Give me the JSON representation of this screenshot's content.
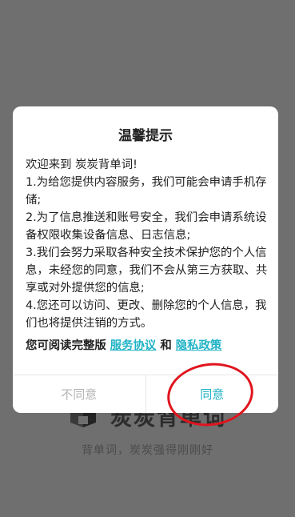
{
  "background": {
    "app_name": "炭炭背单词",
    "tagline": "背单词，炭炭强得刚刚好"
  },
  "dialog": {
    "title": "温馨提示",
    "paragraphs": [
      "欢迎来到 炭炭背单词!",
      " 1.为给您提供内容服务，我们可能会申请手机存储;",
      " 2.为了信息推送和账号安全，我们会申请系统设备权限收集设备信息、日志信息;",
      " 3.我们会努力采取各种安全技术保护您的个人信息，未经您的同意，我们不会从第三方获取、共享或对外提供您的信息;",
      " 4.您还可以访问、更改、删除您的个人信息，我们也将提供注销的方式。"
    ],
    "policy_prefix": "您可阅读完整版 ",
    "service_agreement": "服务协议",
    "policy_and": " 和 ",
    "privacy_policy": "隐私政策",
    "disagree_label": "不同意",
    "agree_label": "同意"
  },
  "colors": {
    "accent": "#20b3c6",
    "annotation": "#e0141e",
    "overlay": "#6f6f6f"
  }
}
